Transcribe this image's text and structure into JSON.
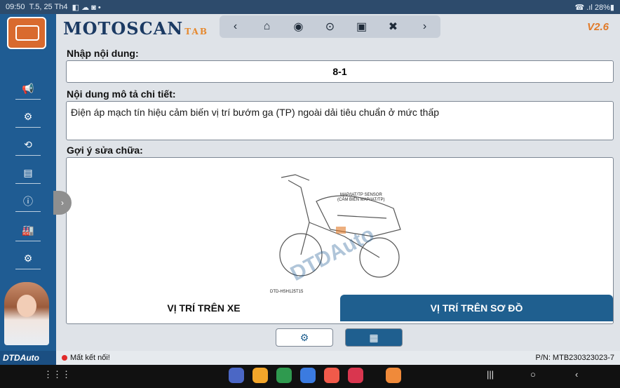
{
  "status_bar": {
    "time": "09:50",
    "date": "T.5, 25 Th4",
    "notifications": "◧ ☁ ◙ •",
    "battery": "☎ .ıl 28%▮"
  },
  "sidebar": {
    "items": [
      {
        "icon": "megaphone-icon",
        "glyph": "📢"
      },
      {
        "icon": "car-engine-icon",
        "glyph": "⚙"
      },
      {
        "icon": "history-icon",
        "glyph": "⟲"
      },
      {
        "icon": "clipboard-icon",
        "glyph": "▤"
      },
      {
        "icon": "info-icon",
        "glyph": "ⓘ"
      },
      {
        "icon": "factory-icon",
        "glyph": "🏭"
      },
      {
        "icon": "settings-icon",
        "glyph": "⚙"
      }
    ],
    "brand": "DTDAuto"
  },
  "header": {
    "title": "MOTOSCAN",
    "title_suffix": "TAB",
    "version": "V2.6",
    "nav": [
      "‹",
      "⌂",
      "◉",
      "⊙",
      "▣",
      "✖",
      "›"
    ]
  },
  "fields": {
    "code_label": "Nhập nội dung:",
    "code_value": "8-1",
    "desc_label": "Nội dung mô tả chi tiết:",
    "desc_value": "Điện áp mạch tín hiệu cảm biến vị trí bướm ga (TP) ngoài dải tiêu chuẩn ở mức thấp",
    "repair_label": "Gợi ý sửa chữa:"
  },
  "diagram": {
    "sensor_label_1": "MAP/IAT/TP SENSOR",
    "sensor_label_2": "(CẢM BIẾN MAP/IAT/TP)",
    "watermark": "DTDAuto",
    "caption": "DTD-HSH125T15"
  },
  "buttons": {
    "on_vehicle": "VỊ TRÍ TRÊN XE",
    "on_diagram": "VỊ TRÍ TRÊN SƠ ĐỒ",
    "pg_left_icon": "⚙",
    "pg_right_icon": "▦"
  },
  "footer": {
    "status": "Mất kết nối!",
    "pn": "P/N: MTB230323023-7"
  },
  "system_nav": {
    "apps": [
      "#4b67c5",
      "#f3a62a",
      "#2f9a4f",
      "#3b7be0",
      "#f15a4a",
      "#d9364f",
      "#f08a3a"
    ],
    "grid": "⋮⋮⋮",
    "recents": "|||",
    "home": "○",
    "back": "‹"
  },
  "colors": {
    "sidebar": "#1f5c93",
    "accent": "#e17a28",
    "active_button": "#1f5f8f"
  }
}
